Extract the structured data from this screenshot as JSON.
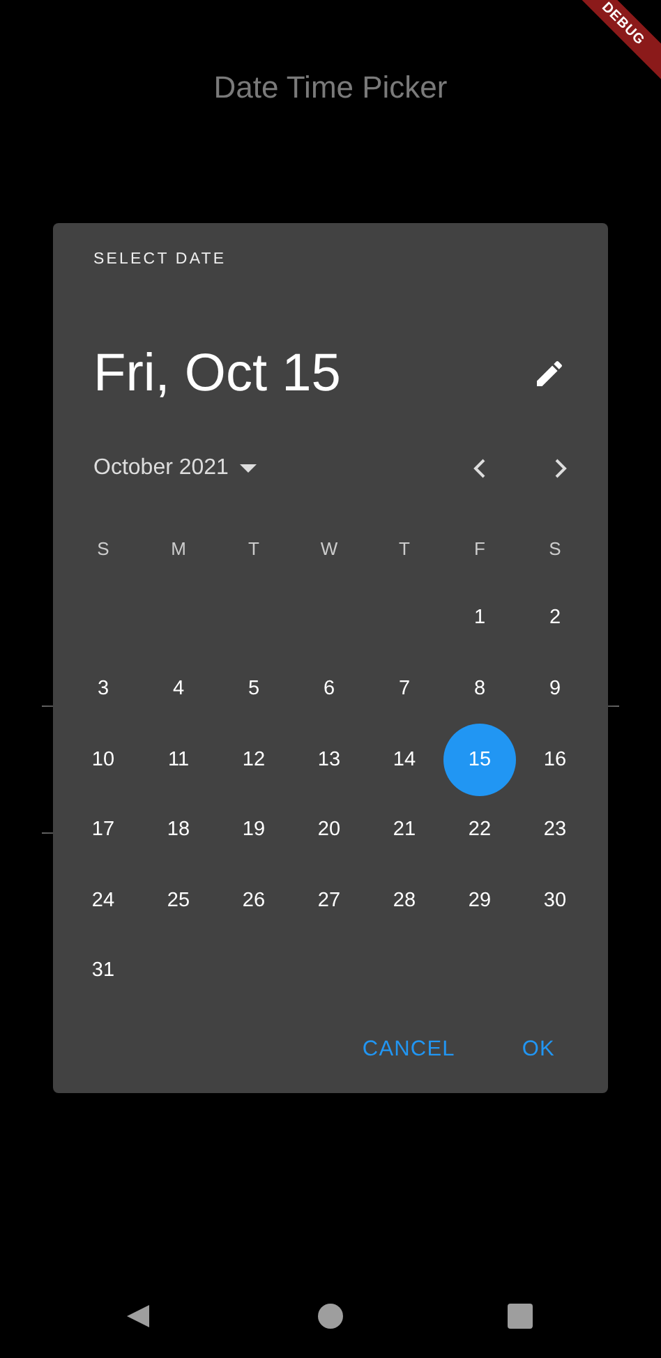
{
  "app_bar": {
    "title": "Date Time Picker"
  },
  "debug_banner": {
    "label": "DEBUG"
  },
  "dialog": {
    "header_label": "SELECT DATE",
    "selected_date": "Fri, Oct 15",
    "month_label": "October 2021",
    "weekdays": [
      "S",
      "M",
      "T",
      "W",
      "T",
      "F",
      "S"
    ],
    "weeks": [
      {
        "kind": "lead",
        "days": [
          {
            "label": "1",
            "selected": false
          },
          {
            "label": "2",
            "selected": false
          }
        ]
      },
      {
        "kind": "full",
        "days": [
          {
            "label": "3",
            "selected": false
          },
          {
            "label": "4",
            "selected": false
          },
          {
            "label": "5",
            "selected": false
          },
          {
            "label": "6",
            "selected": false
          },
          {
            "label": "7",
            "selected": false
          },
          {
            "label": "8",
            "selected": false
          },
          {
            "label": "9",
            "selected": false
          }
        ]
      },
      {
        "kind": "full",
        "days": [
          {
            "label": "10",
            "selected": false
          },
          {
            "label": "11",
            "selected": false
          },
          {
            "label": "12",
            "selected": false
          },
          {
            "label": "13",
            "selected": false
          },
          {
            "label": "14",
            "selected": false
          },
          {
            "label": "15",
            "selected": true
          },
          {
            "label": "16",
            "selected": false
          }
        ]
      },
      {
        "kind": "full",
        "days": [
          {
            "label": "17",
            "selected": false
          },
          {
            "label": "18",
            "selected": false
          },
          {
            "label": "19",
            "selected": false
          },
          {
            "label": "20",
            "selected": false
          },
          {
            "label": "21",
            "selected": false
          },
          {
            "label": "22",
            "selected": false
          },
          {
            "label": "23",
            "selected": false
          }
        ]
      },
      {
        "kind": "full",
        "days": [
          {
            "label": "24",
            "selected": false
          },
          {
            "label": "25",
            "selected": false
          },
          {
            "label": "26",
            "selected": false
          },
          {
            "label": "27",
            "selected": false
          },
          {
            "label": "28",
            "selected": false
          },
          {
            "label": "29",
            "selected": false
          },
          {
            "label": "30",
            "selected": false
          }
        ]
      },
      {
        "kind": "full",
        "days": [
          {
            "label": "31",
            "selected": false
          }
        ]
      }
    ],
    "buttons": [
      "CANCEL",
      "OK"
    ]
  }
}
